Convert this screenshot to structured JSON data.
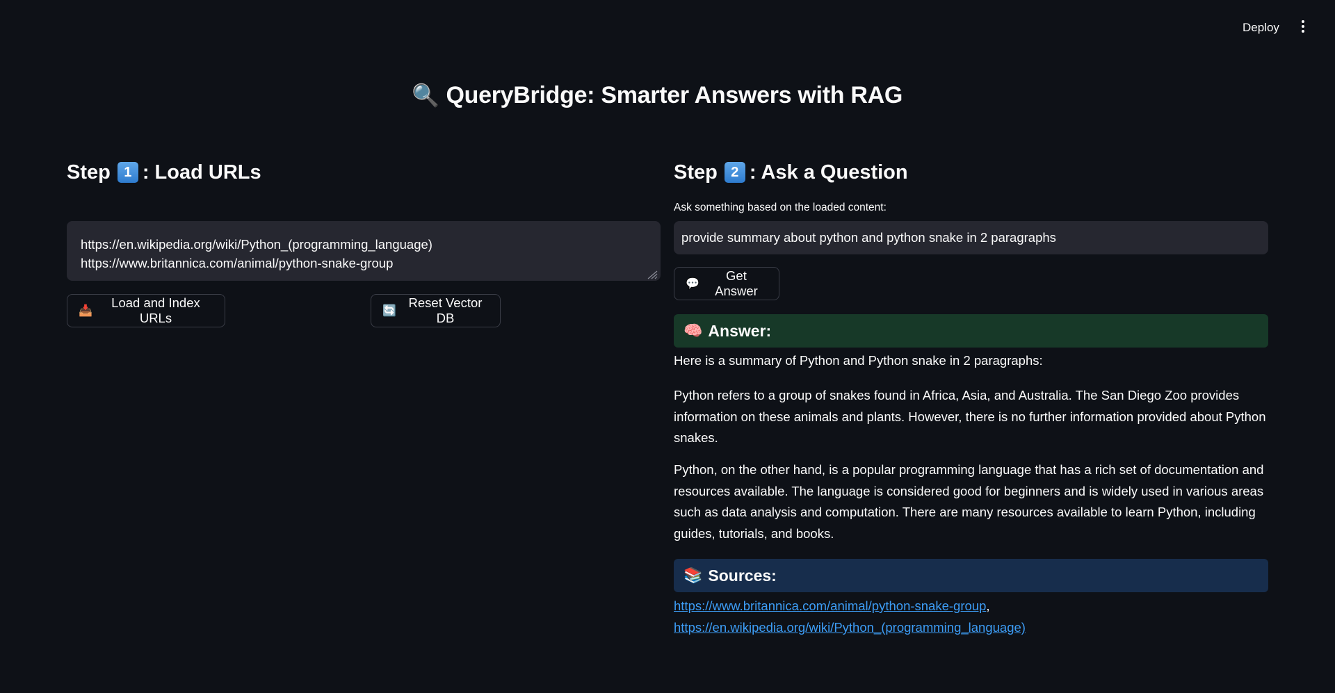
{
  "header": {
    "deploy_label": "Deploy",
    "menu_icon": "kebab-menu-icon"
  },
  "title": {
    "icon": "🔍",
    "text": "QueryBridge: Smarter Answers with RAG"
  },
  "step1": {
    "prefix": "Step",
    "number": "1",
    "suffix": ": Load URLs",
    "urls_line1": "https://en.wikipedia.org/wiki/Python_(programming_language)",
    "urls_line2": "https://www.britannica.com/animal/python-snake-group",
    "load_button_icon": "📥",
    "load_button_label": "Load and Index URLs",
    "reset_button_icon": "🔄",
    "reset_button_label": "Reset Vector DB"
  },
  "step2": {
    "prefix": "Step",
    "number": "2",
    "suffix": ": Ask a Question",
    "input_label": "Ask something based on the loaded content:",
    "question_value": "provide summary about python and python snake in 2 paragraphs",
    "get_answer_icon": "💬",
    "get_answer_label": "Get Answer",
    "answer_header_icon": "🧠",
    "answer_header": "Answer:",
    "answer_intro": "Here is a summary of Python and Python snake in 2 paragraphs:",
    "answer_p1": "Python refers to a group of snakes found in Africa, Asia, and Australia. The San Diego Zoo provides information on these animals and plants. However, there is no further information provided about Python snakes.",
    "answer_p2": "Python, on the other hand, is a popular programming language that has a rich set of documentation and resources available. The language is considered good for beginners and is widely used in various areas such as data analysis and computation. There are many resources available to learn Python, including guides, tutorials, and books.",
    "sources_header_icon": "📚",
    "sources_header": "Sources:",
    "source1": "https://www.britannica.com/animal/python-snake-group",
    "separator": ", ",
    "source2": "https://en.wikipedia.org/wiki/Python_(programming_language)"
  },
  "colors": {
    "background": "#0e1117",
    "input_bg": "#262730",
    "answer_bg": "#173928",
    "sources_bg": "#172d4c",
    "link": "#3d9df6"
  }
}
